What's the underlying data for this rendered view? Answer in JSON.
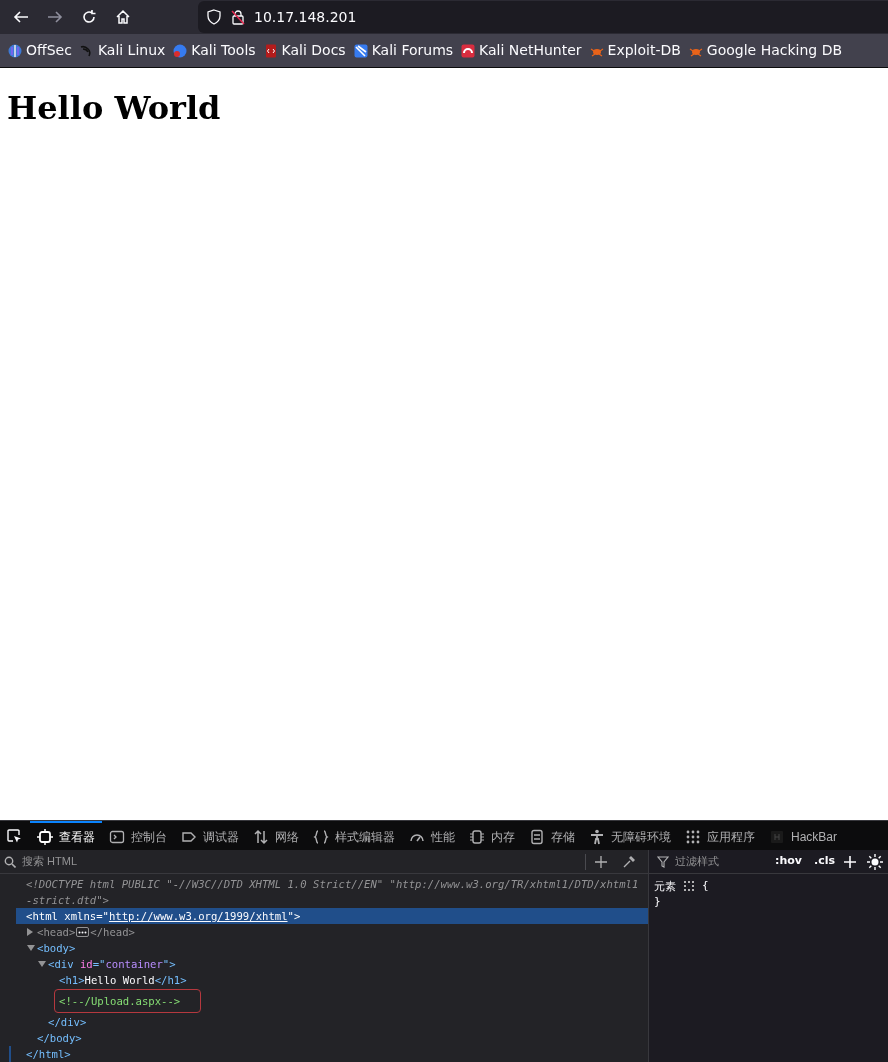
{
  "browser": {
    "nav_buttons": [
      {
        "kind": "back",
        "disabled": false
      },
      {
        "kind": "forward",
        "disabled": true
      },
      {
        "kind": "reload",
        "disabled": false
      },
      {
        "kind": "home",
        "disabled": false
      }
    ],
    "url": "10.17.148.201",
    "bookmarks": [
      "OffSec",
      "Kali Linux",
      "Kali Tools",
      "Kali Docs",
      "Kali Forums",
      "Kali NetHunter",
      "Exploit-DB",
      "Google Hacking DB"
    ]
  },
  "page": {
    "heading": "Hello World"
  },
  "devtools": {
    "tabs": [
      {
        "label": "查看器",
        "kind": "inspector",
        "selected": true
      },
      {
        "label": "控制台",
        "kind": "console",
        "selected": false
      },
      {
        "label": "调试器",
        "kind": "debugger",
        "selected": false
      },
      {
        "label": "网络",
        "kind": "network",
        "selected": false
      },
      {
        "label": "样式编辑器",
        "kind": "style",
        "selected": false
      },
      {
        "label": "性能",
        "kind": "performance",
        "selected": false
      },
      {
        "label": "内存",
        "kind": "memory",
        "selected": false
      },
      {
        "label": "存储",
        "kind": "storage",
        "selected": false
      },
      {
        "label": "无障碍环境",
        "kind": "accessibility",
        "selected": false
      },
      {
        "label": "应用程序",
        "kind": "application",
        "selected": false
      },
      {
        "label": "HackBar",
        "kind": "hackbar",
        "selected": false
      }
    ],
    "search": {
      "placeholder": "搜索 HTML"
    },
    "markup": [
      {
        "open": [
          {
            "kind": "doctype",
            "text": "<!DOCTYPE html PUBLIC \"-//W3C//DTD XHTML 1.0 Strict//EN\" \"http://www.w3.org/TR/xhtml1/DTD/xhtml1-strict.dtd\">"
          }
        ]
      },
      {
        "selected": true,
        "open": [
          {
            "kind": "tag",
            "text": "<html "
          },
          {
            "kind": "attr",
            "text": "xmlns"
          },
          {
            "kind": "punct",
            "text": "=\""
          },
          {
            "kind": "link",
            "text": "http://www.w3.org/1999/xhtml"
          },
          {
            "kind": "punct",
            "text": "\">"
          }
        ],
        "close": [
          {
            "kind": "tag",
            "text": "</html>"
          }
        ],
        "children": [
          {
            "expanded": false,
            "open": [
              {
                "kind": "dimtag",
                "text": "<head>"
              }
            ],
            "close": [
              {
                "kind": "dimtag",
                "text": "</head>"
              }
            ]
          },
          {
            "expanded": true,
            "open": [
              {
                "kind": "tag",
                "text": "<body>"
              }
            ],
            "close": [
              {
                "kind": "tag",
                "text": "</body>"
              }
            ],
            "children": [
              {
                "expanded": true,
                "open": [
                  {
                    "kind": "tag",
                    "text": "<div "
                  },
                  {
                    "kind": "attr",
                    "text": "id"
                  },
                  {
                    "kind": "punct",
                    "text": "=\""
                  },
                  {
                    "kind": "value",
                    "text": "container"
                  },
                  {
                    "kind": "punct",
                    "text": "\">"
                  }
                ],
                "close": [
                  {
                    "kind": "tag",
                    "text": "</div>"
                  }
                ],
                "children": [
                  {
                    "open": [
                      {
                        "kind": "tag",
                        "text": "<h1>"
                      },
                      {
                        "kind": "text",
                        "text": "Hello World"
                      },
                      {
                        "kind": "tag",
                        "text": "</h1>"
                      }
                    ]
                  },
                  {
                    "highlighted": true,
                    "open": [
                      {
                        "kind": "comment",
                        "text": "<!--/Upload.aspx-->"
                      }
                    ]
                  }
                ]
              }
            ]
          }
        ]
      }
    ],
    "styles": {
      "filter_placeholder": "过滤样式",
      "hov": ":hov",
      "cls": ".cls",
      "selector": "元素",
      "open_brace": "{",
      "close_brace": "}"
    }
  }
}
